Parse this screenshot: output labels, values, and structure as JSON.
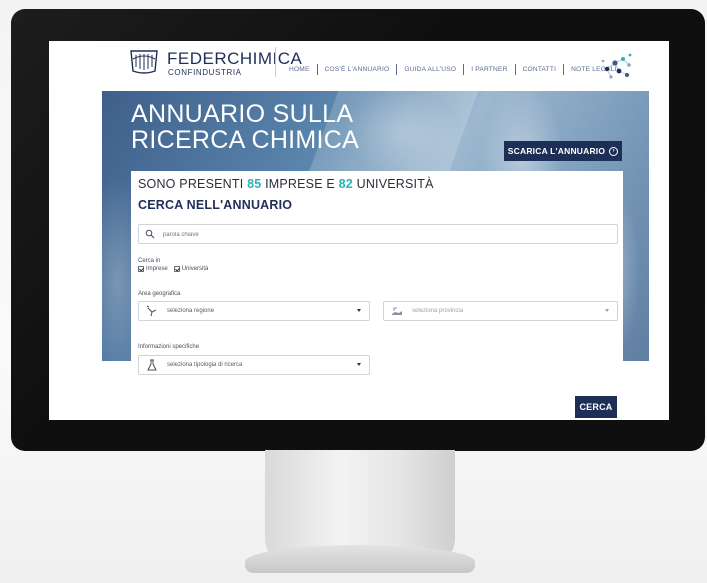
{
  "header": {
    "brand_title": "FEDERCHIMICA",
    "brand_subtitle": "CONFINDUSTRIA",
    "nav": [
      {
        "label": "HOME"
      },
      {
        "label": "COS'È L'ANNUARIO"
      },
      {
        "label": "GUIDA ALL'USO"
      },
      {
        "label": "I PARTNER"
      },
      {
        "label": "CONTATTI"
      },
      {
        "label": "NOTE LEGALI"
      }
    ]
  },
  "hero": {
    "title_line1": "ANNUARIO SULLA",
    "title_line2": "RICERCA CHIMICA",
    "download_label": "SCARICA L'ANNUARIO",
    "download_icon": "arrow-circle-icon"
  },
  "stats": {
    "prefix": "SONO PRESENTI ",
    "imprese_count": "85",
    "middle": " IMPRESE E ",
    "universita_count": "82",
    "suffix": " UNIVERSITÀ"
  },
  "search": {
    "title": "CERCA NELL'ANNUARIO",
    "keyword_placeholder": "parola chiave",
    "search_in_label": "Cerca in",
    "checkbox_imprese": "Imprese",
    "checkbox_universita": "Università",
    "area_label": "Area geografica",
    "region_placeholder": "seleziona regione",
    "province_placeholder": "seleziona provincia",
    "info_label": "Informazioni specifiche",
    "research_type_placeholder": "seleziona tipologia di ricerca",
    "submit_label": "CERCA"
  },
  "colors": {
    "brand_navy": "#1e2f57",
    "accent_teal": "#2bb3b7"
  }
}
